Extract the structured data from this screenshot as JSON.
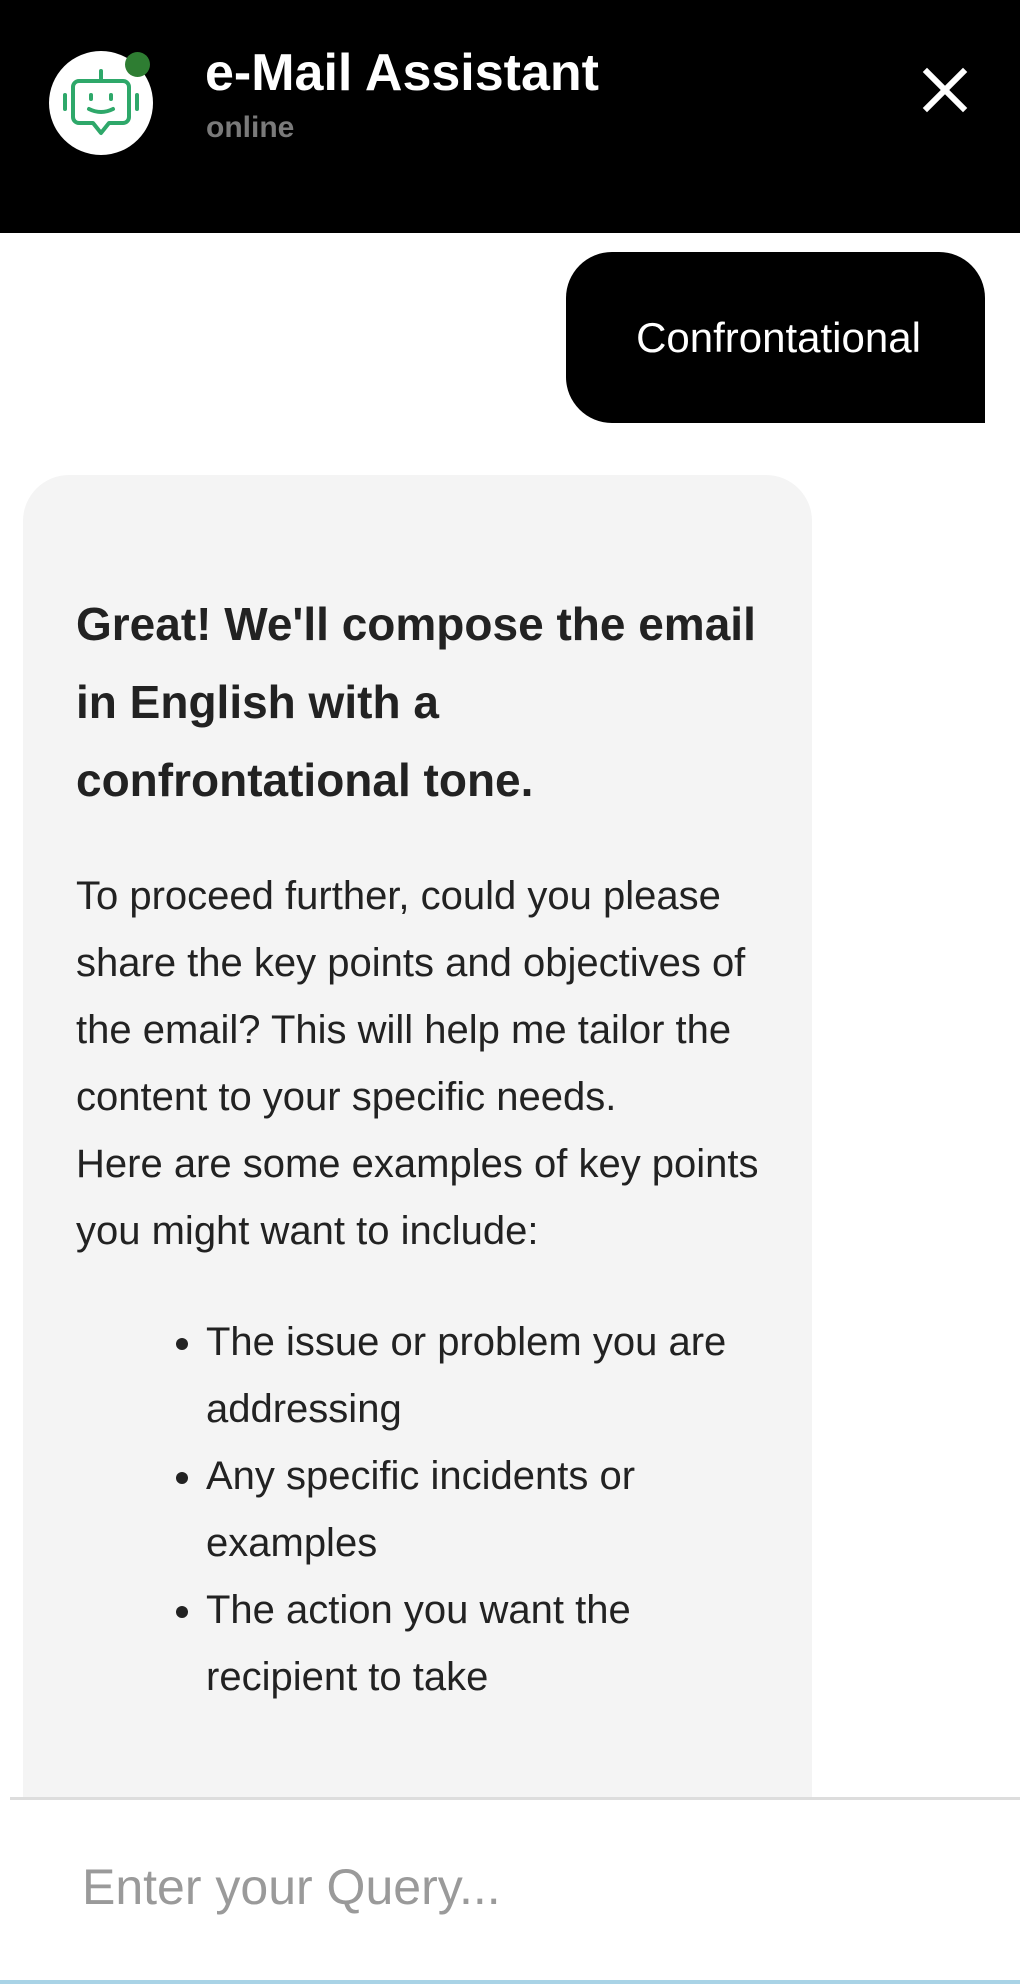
{
  "header": {
    "title": "e-Mail Assistant",
    "status": "online",
    "accent_color": "#2ea86a",
    "status_color": "#2e7d32",
    "avatar_icon": "robot-chat-icon",
    "close_icon": "close-icon"
  },
  "messages": {
    "user": {
      "text": "Confrontational"
    },
    "bot": {
      "heading": "Great! We'll compose the email in English with a confrontational tone.",
      "paragraph1": "To proceed further, could you please share the key points and objectives of the email? This will help me tailor the content to your specific needs.",
      "paragraph2": "Here are some examples of key points you might want to include:",
      "list": [
        "The issue or problem you are addressing",
        "Any specific incidents or examples",
        "The action you want the recipient to take"
      ]
    }
  },
  "input": {
    "placeholder": "Enter your Query..."
  }
}
